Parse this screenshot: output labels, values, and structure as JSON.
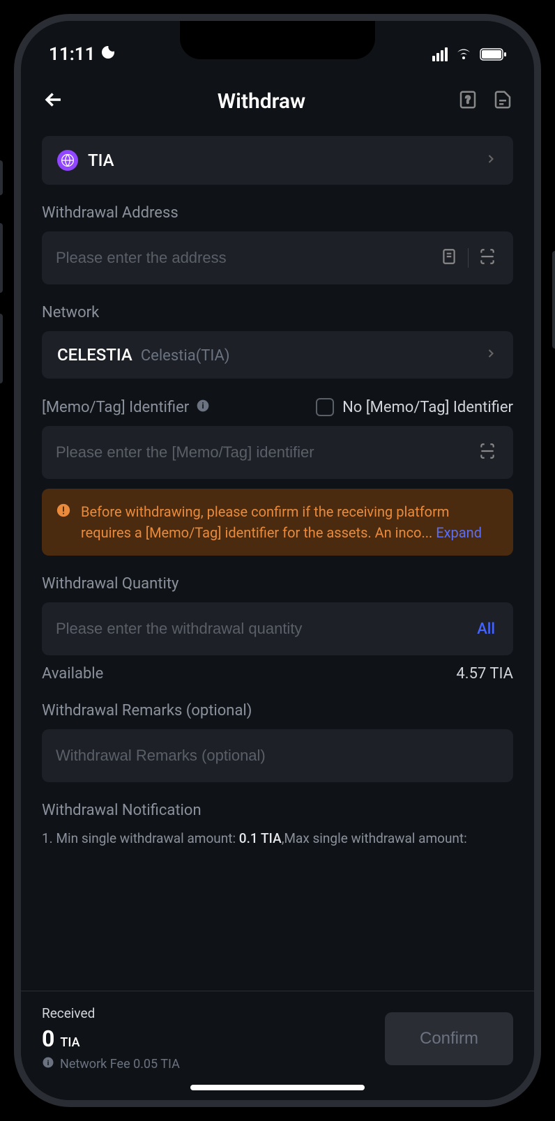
{
  "status": {
    "time": "11:11"
  },
  "header": {
    "title": "Withdraw"
  },
  "coin": {
    "symbol": "TIA"
  },
  "address": {
    "label": "Withdrawal Address",
    "placeholder": "Please enter the address"
  },
  "network": {
    "label": "Network",
    "code": "CELESTIA",
    "name": "Celestia(TIA)"
  },
  "memo": {
    "label": "[Memo/Tag] Identifier",
    "checkbox_label": "No [Memo/Tag] Identifier",
    "placeholder": "Please enter the [Memo/Tag] identifier",
    "warning": "Before withdrawing, please confirm if the receiving platform requires a [Memo/Tag] identifier for the assets. An inco... ",
    "expand": "Expand"
  },
  "quantity": {
    "label": "Withdrawal Quantity",
    "placeholder": "Please enter the withdrawal quantity",
    "all_label": "All",
    "available_label": "Available",
    "available_value": "4.57 TIA"
  },
  "remarks": {
    "label": "Withdrawal Remarks (optional)",
    "placeholder": "Withdrawal Remarks (optional)"
  },
  "notification": {
    "title": "Withdrawal Notification",
    "line1_prefix": "1. Min single withdrawal amount: ",
    "line1_highlight": "0.1 TIA",
    "line1_suffix": ",Max single withdrawal amount:"
  },
  "footer": {
    "received_label": "Received",
    "received_value": "0",
    "received_coin": "TIA",
    "fee_label": "Network Fee 0.05 TIA",
    "confirm": "Confirm"
  }
}
